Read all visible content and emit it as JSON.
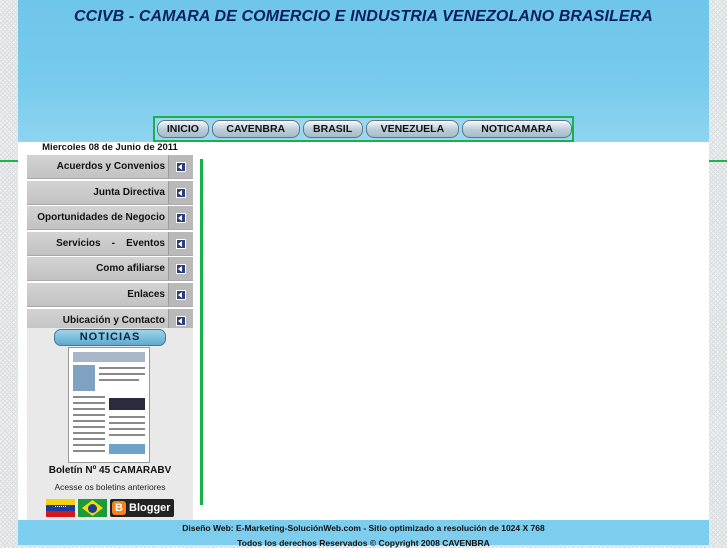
{
  "header": {
    "title": "CCIVB - CAMARA DE COMERCIO E INDUSTRIA VENEZOLANO BRASILERA"
  },
  "nav": {
    "items": [
      "INICIO",
      "CAVENBRA",
      "BRASIL",
      "VENEZUELA",
      "NOTICAMARA"
    ]
  },
  "date": "Miercoles 08 de Junio de 2011",
  "sidebar": {
    "items": [
      {
        "label": "Acuerdos y Convenios"
      },
      {
        "label": "Junta Directiva"
      },
      {
        "label": "Oportunidades de Negocio"
      },
      {
        "label": "Servicios    -    Eventos"
      },
      {
        "label": "Como afiliarse"
      },
      {
        "label": "Enlaces"
      },
      {
        "label": "Ubicación y Contacto"
      }
    ]
  },
  "news": {
    "header": "NOTICIAS",
    "bulletin_title": "Boletín Nº 45 CAMARABV",
    "bulletin_link": "Acesse os boletins anteriores",
    "blogger_label": "Blogger",
    "blogger_icon_letter": "B"
  },
  "footer": {
    "line1": "Diseño Web: E-Marketing-SoluciónWeb.com - Sitio optimizado a resolución de 1024 X 768",
    "line2": "Todos los derechos Reservados © Copyright 2008 CAVENBRA"
  },
  "colors": {
    "header_bg": "#78cbec",
    "accent_green": "#16b24a",
    "title_color": "#0c1f5c"
  }
}
